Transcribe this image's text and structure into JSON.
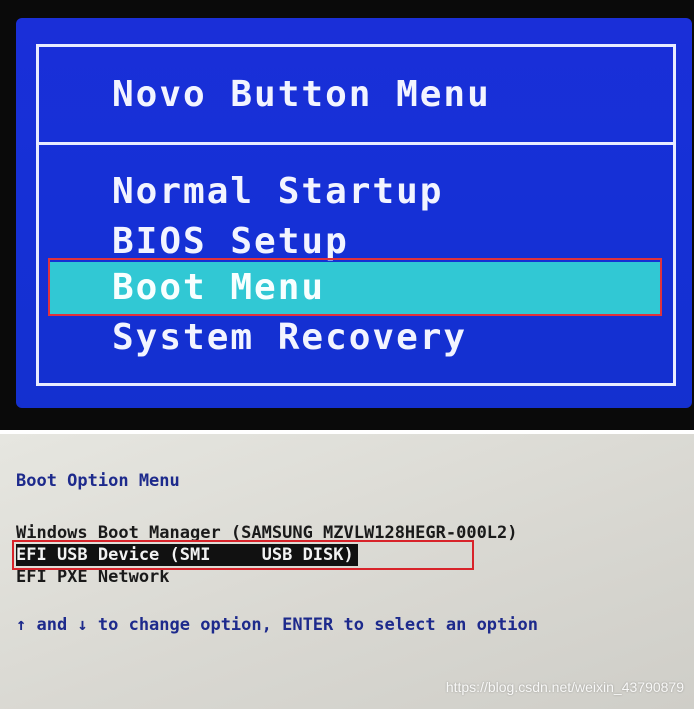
{
  "novo_menu": {
    "title": "Novo Button Menu",
    "items": [
      {
        "label": "Normal Startup"
      },
      {
        "label": "BIOS Setup"
      },
      {
        "label": "Boot Menu",
        "selected": true
      },
      {
        "label": "System Recovery"
      }
    ],
    "colors": {
      "background": "#1530d6",
      "highlight": "#31c8d4",
      "text": "#f2f4ff",
      "annotation": "#e0323c"
    }
  },
  "boot_option_menu": {
    "title": "Boot Option Menu",
    "options": [
      {
        "label": "Windows Boot Manager (SAMSUNG MZVLW128HEGR-000L2)"
      },
      {
        "label": "EFI USB Device (SMI     USB DISK)",
        "selected": true
      },
      {
        "label": "EFI PXE Network"
      }
    ],
    "hint": "↑ and ↓ to change option, ENTER to select an option",
    "colors": {
      "title": "#1d2a8c",
      "text": "#1a1a1a",
      "selected_bg": "#111111",
      "annotation": "#d8232a"
    }
  },
  "watermark": "https://blog.csdn.net/weixin_43790879"
}
